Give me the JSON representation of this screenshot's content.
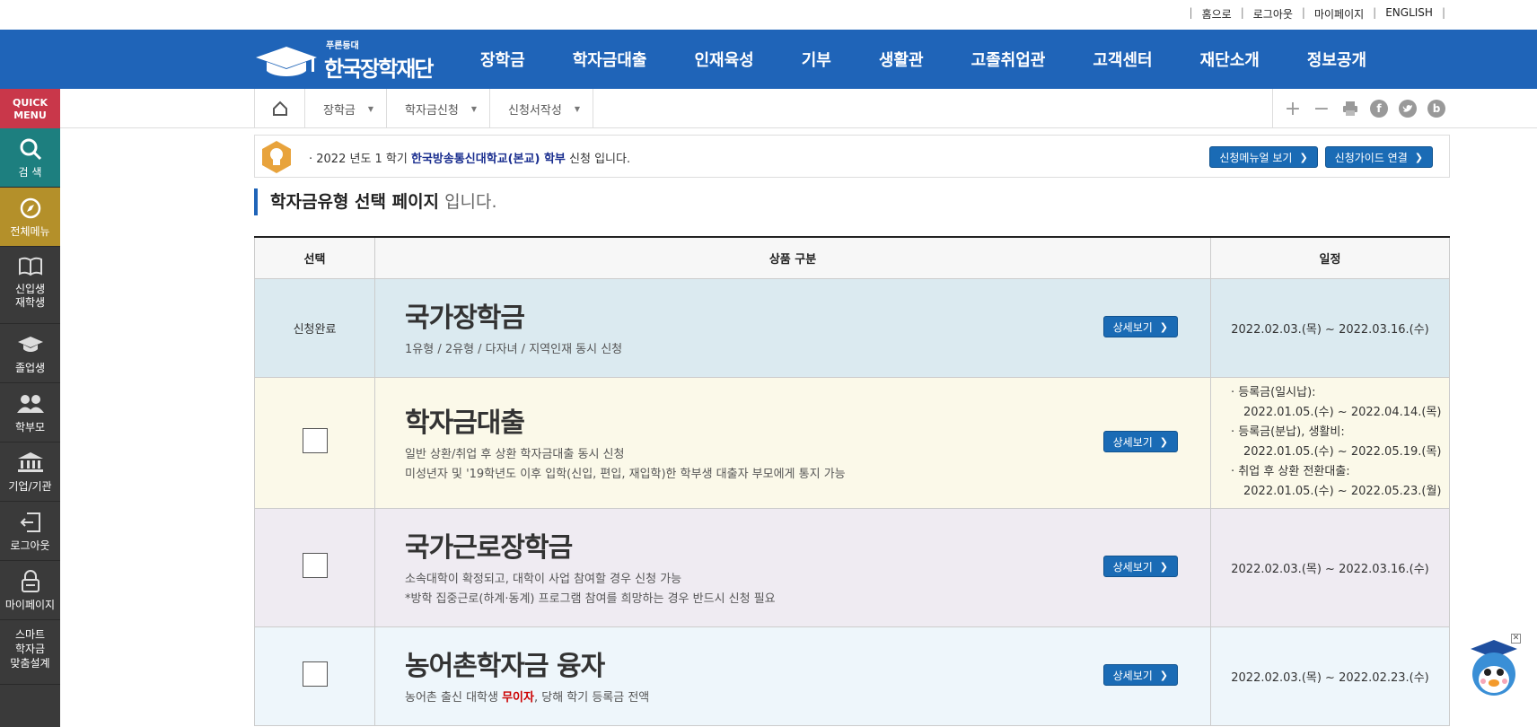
{
  "util": {
    "home": "홈으로",
    "logout": "로그아웃",
    "mypage": "마이페이지",
    "english": "ENGLISH"
  },
  "logo": {
    "sub": "푸른등대",
    "name": "한국장학재단"
  },
  "gnb": [
    "장학금",
    "학자금대출",
    "인재육성",
    "기부",
    "생활관",
    "고졸취업관",
    "고객센터",
    "재단소개",
    "정보공개"
  ],
  "quick": {
    "title_1": "QUICK",
    "title_2": "MENU",
    "items": [
      {
        "label": "검 색",
        "icon": "search-icon"
      },
      {
        "label": "전체메뉴",
        "icon": "compass-icon"
      },
      {
        "label_1": "신입생",
        "label_2": "재학생",
        "icon": "book-icon"
      },
      {
        "label": "졸업생",
        "icon": "graduation-cap-icon"
      },
      {
        "label": "학부모",
        "icon": "parents-icon"
      },
      {
        "label": "기업/기관",
        "icon": "building-icon"
      },
      {
        "label": "로그아웃",
        "icon": "logout-icon"
      },
      {
        "label": "마이페이지",
        "icon": "lock-icon"
      },
      {
        "label_1": "스마트",
        "label_2": "학자금",
        "label_3": "맞춤설계",
        "icon": "smart-icon"
      }
    ]
  },
  "breadcrumb": [
    "장학금",
    "학자금신청",
    "신청서작성"
  ],
  "tools": {
    "plus": "+",
    "minus": "−",
    "facebook": "f",
    "blog": "b"
  },
  "notice": {
    "prefix": "· 2022 년도 1 학기 ",
    "school": "한국방송통신대학교(본교) 학부",
    "suffix": " 신청 입니다.",
    "btn_manual": "신청메뉴얼 보기",
    "btn_guide": "신청가이드 연결"
  },
  "page_title": {
    "bold": "학자금유형 선택 페이지",
    "rest": " 입니다."
  },
  "table": {
    "headers": [
      "선택",
      "상품 구분",
      "일정"
    ],
    "detail_label": "상세보기",
    "rows": [
      {
        "status": "신청완료",
        "title": "국가장학금",
        "desc_1": "1유형 / 2유형 / 다자녀 / 지역인재 동시 신청",
        "date": "2022.02.03.(목) ~ 2022.03.16.(수)"
      },
      {
        "title": "학자금대출",
        "desc_1": "일반 상환/취업 후 상환 학자금대출 동시 신청",
        "desc_2": "미성년자 및 '19학년도 이후 입학(신입, 편입, 재입학)한 학부생 대출자 부모에게 통지 가능",
        "dates": {
          "l1": "· 등록금(일시납):",
          "l2": "2022.01.05.(수) ~ 2022.04.14.(목)",
          "l3": "· 등록금(분납), 생활비:",
          "l4": "2022.01.05.(수) ~ 2022.05.19.(목)",
          "l5": "· 취업 후 상환 전환대출:",
          "l6": "2022.01.05.(수) ~ 2022.05.23.(월)"
        }
      },
      {
        "title": "국가근로장학금",
        "desc_1": "소속대학이 확정되고, 대학이 사업 참여할 경우 신청 가능",
        "desc_2": "*방학 집중근로(하계·동계) 프로그램 참여를 희망하는 경우 반드시 신청 필요",
        "date": "2022.02.03.(목) ~ 2022.03.16.(수)"
      },
      {
        "title": "농어촌학자금 융자",
        "desc_pre": "농어촌 출신 대학생 ",
        "desc_red": "무이자",
        "desc_post": ", 당해 학기 등록금 전액",
        "date": "2022.02.03.(목) ~ 2022.02.23.(수)"
      }
    ]
  },
  "colors": {
    "brand_blue": "#1f64b8",
    "quick_red": "#c9374a",
    "quick_gold": "#b4902a",
    "quick_teal": "#1d7f7f"
  }
}
